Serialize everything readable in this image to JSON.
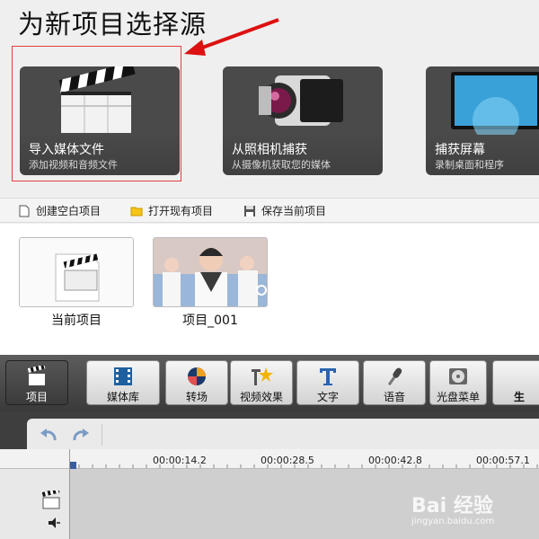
{
  "header": {
    "title": "为新项目选择源"
  },
  "sources": [
    {
      "title": "导入媒体文件",
      "subtitle": "添加视频和音频文件",
      "icon": "clapperboard-icon"
    },
    {
      "title": "从照相机捕获",
      "subtitle": "从摄像机获取您的媒体",
      "icon": "camcorder-icon"
    },
    {
      "title": "捕获屏幕",
      "subtitle": "录制桌面和程序",
      "icon": "monitor-icon"
    }
  ],
  "actions": [
    {
      "label": "创建空白项目",
      "icon": "blank-document-icon"
    },
    {
      "label": "打开现有项目",
      "icon": "folder-icon"
    },
    {
      "label": "保存当前项目",
      "icon": "floppy-disk-icon"
    }
  ],
  "projects": [
    {
      "label": "当前项目"
    },
    {
      "label": "项目_001"
    }
  ],
  "toolbar": [
    {
      "label": "项目",
      "icon": "clapperboard-icon",
      "active": true
    },
    {
      "label": "媒体库",
      "icon": "film-strip-icon"
    },
    {
      "label": "转场",
      "icon": "transition-icon"
    },
    {
      "label": "视频效果",
      "icon": "effects-star-icon"
    },
    {
      "label": "文字",
      "icon": "text-t-icon"
    },
    {
      "label": "语音",
      "icon": "microphone-icon"
    },
    {
      "label": "光盘菜单",
      "icon": "disc-menu-icon"
    },
    {
      "label": "生",
      "icon": "produce-icon"
    }
  ],
  "timeline": {
    "ticks": [
      "00:00:14.2",
      "00:00:28.5",
      "00:00:42.8",
      "00:00:57.1"
    ]
  },
  "watermark": {
    "brand": "Bai 经验",
    "url": "jingyan.baidu.com"
  },
  "colors": {
    "selection": "#e04040",
    "toolbar_bg": "#4a4a4a",
    "tile_bg": "#4d4d4d"
  }
}
